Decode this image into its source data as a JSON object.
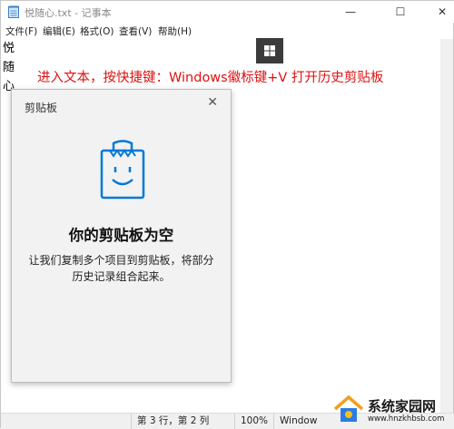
{
  "window": {
    "title": "悦随心.txt - 记事本",
    "controls": {
      "minimize": "—",
      "maximize": "☐",
      "close": "✕"
    }
  },
  "menu": [
    {
      "label": "文件(F)"
    },
    {
      "label": "编辑(E)"
    },
    {
      "label": "格式(O)"
    },
    {
      "label": "查看(V)"
    },
    {
      "label": "帮助(H)"
    }
  ],
  "editor": {
    "text": "悦随心"
  },
  "annotation": {
    "text": "进入文本，按快捷键：Windows徽标键+V 打开历史剪贴板"
  },
  "clipboard_panel": {
    "title": "剪贴板",
    "close": "✕",
    "heading": "你的剪贴板为空",
    "description": "让我们复制多个项目到剪贴板，将部分历史记录组合起来。",
    "icon": "clipboard-smile-icon"
  },
  "statusbar": {
    "position": "第 3 行，第 2 列",
    "zoom": "100%",
    "line_ending": "Window"
  },
  "watermark": {
    "title": "系统家园网",
    "url": "www.hnzkhbsb.com"
  },
  "colors": {
    "annotation": "#e01010",
    "accent": "#0078d7",
    "panel_bg": "#f2f2f2"
  }
}
